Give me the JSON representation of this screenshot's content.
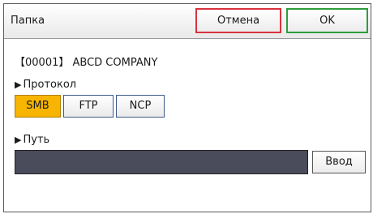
{
  "window": {
    "title": "Папка"
  },
  "toolbar": {
    "cancel_label": "Отмена",
    "ok_label": "OK"
  },
  "destination": {
    "label": "【00001】 ABCD COMPANY"
  },
  "protocol": {
    "label": "Протокол",
    "options": [
      "SMB",
      "FTP",
      "NCP"
    ],
    "selected": "SMB"
  },
  "path": {
    "label": "Путь",
    "value": "",
    "enter_label": "Ввод"
  },
  "colors": {
    "selected": "#f7b500",
    "cancel_border": "#d8333f",
    "ok_border": "#2f9d3c",
    "field_background": "#4a4c5c"
  }
}
